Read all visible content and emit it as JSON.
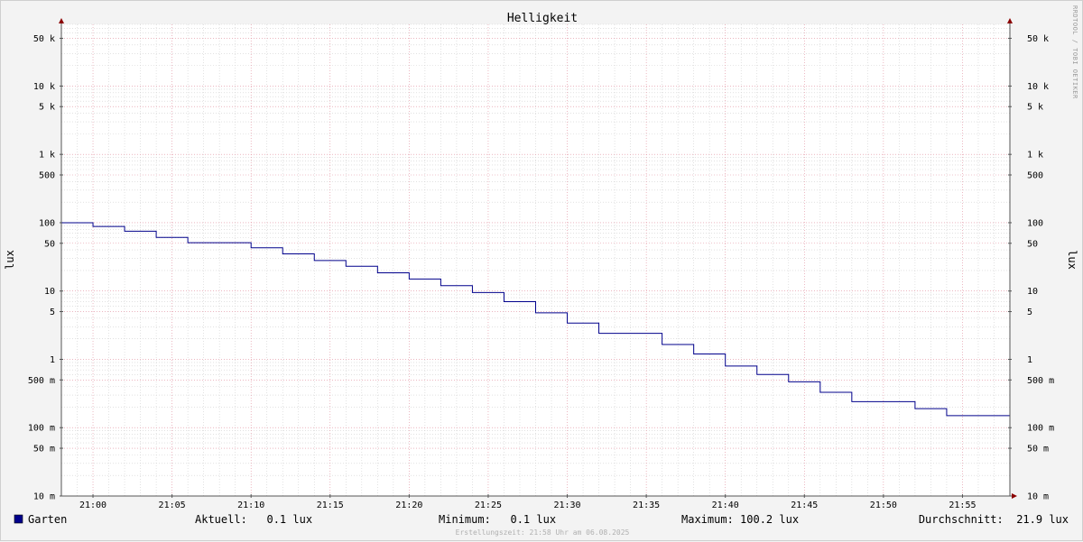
{
  "chart_data": {
    "type": "line",
    "title": "Helligkeit",
    "ylabel": "lux",
    "ylabel_right": "lux",
    "y_scale": "log",
    "ylim": [
      0.01,
      80000
    ],
    "xlim": [
      "20:58",
      "21:58"
    ],
    "y_ticks": [
      {
        "value": 50000,
        "label": "50 k"
      },
      {
        "value": 10000,
        "label": "10 k"
      },
      {
        "value": 5000,
        "label": "5 k"
      },
      {
        "value": 1000,
        "label": "1 k"
      },
      {
        "value": 500,
        "label": "500"
      },
      {
        "value": 100,
        "label": "100"
      },
      {
        "value": 50,
        "label": "50"
      },
      {
        "value": 10,
        "label": "10"
      },
      {
        "value": 5,
        "label": "5"
      },
      {
        "value": 1,
        "label": "1"
      },
      {
        "value": 0.5,
        "label": "500 m"
      },
      {
        "value": 0.1,
        "label": "100 m"
      },
      {
        "value": 0.05,
        "label": "50 m"
      },
      {
        "value": 0.01,
        "label": "10 m"
      }
    ],
    "x_ticks": [
      "21:00",
      "21:05",
      "21:10",
      "21:15",
      "21:20",
      "21:25",
      "21:30",
      "21:35",
      "21:40",
      "21:45",
      "21:50",
      "21:55"
    ],
    "grid": true,
    "legend_position": "bottom-left",
    "series": [
      {
        "name": "Garten",
        "color": "#00008b",
        "points": [
          {
            "x": "20:58",
            "y": 100
          },
          {
            "x": "21:00",
            "y": 88
          },
          {
            "x": "21:02",
            "y": 75
          },
          {
            "x": "21:04",
            "y": 61
          },
          {
            "x": "21:06",
            "y": 51
          },
          {
            "x": "21:10",
            "y": 43
          },
          {
            "x": "21:12",
            "y": 35
          },
          {
            "x": "21:14",
            "y": 28
          },
          {
            "x": "21:16",
            "y": 23
          },
          {
            "x": "21:18",
            "y": 18.5
          },
          {
            "x": "21:20",
            "y": 15
          },
          {
            "x": "21:22",
            "y": 12
          },
          {
            "x": "21:24",
            "y": 9.5
          },
          {
            "x": "21:26",
            "y": 7
          },
          {
            "x": "21:28",
            "y": 4.8
          },
          {
            "x": "21:30",
            "y": 3.4
          },
          {
            "x": "21:32",
            "y": 2.4
          },
          {
            "x": "21:36",
            "y": 1.65
          },
          {
            "x": "21:38",
            "y": 1.2
          },
          {
            "x": "21:40",
            "y": 0.8
          },
          {
            "x": "21:42",
            "y": 0.6
          },
          {
            "x": "21:44",
            "y": 0.47
          },
          {
            "x": "21:46",
            "y": 0.33
          },
          {
            "x": "21:48",
            "y": 0.24
          },
          {
            "x": "21:52",
            "y": 0.19
          },
          {
            "x": "21:54",
            "y": 0.15
          },
          {
            "x": "21:58",
            "y": 0.15
          }
        ]
      }
    ]
  },
  "watermark": "RRDTOOL / TOBI OETIKER",
  "legend": {
    "series_name": "Garten",
    "current": "Aktuell:   0.1 lux",
    "minimum": "Minimum:   0.1 lux",
    "maximum": "Maximum: 100.2 lux",
    "average": "Durchschnitt:  21.9 lux"
  },
  "footer": "Erstellungszeit: 21:58 Uhr am 06.08.2025",
  "colors": {
    "background": "#f3f3f3",
    "plot_background": "#ffffff",
    "major_grid": "#e08a9a",
    "minor_grid": "#cfcfcf",
    "axis": "#555555",
    "arrow": "#8b0000",
    "series": "#00008b"
  }
}
